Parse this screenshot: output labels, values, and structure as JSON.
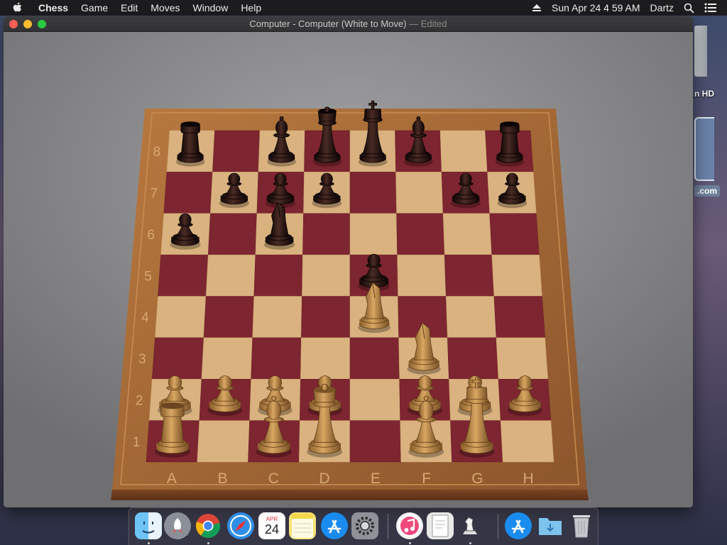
{
  "menubar": {
    "app_name": "Chess",
    "items": [
      "Game",
      "Edit",
      "Moves",
      "Window",
      "Help"
    ],
    "clock": "Sun Apr 24  4 59 AM",
    "user": "Dartz",
    "icons": [
      "apple-icon",
      "eject-icon",
      "spotlight-search-icon",
      "notification-center-icon"
    ]
  },
  "desktop": {
    "hd_label": "n HD",
    "image_label": ".com"
  },
  "window": {
    "title": "Computer - Computer   (White to Move)",
    "edited": " — Edited"
  },
  "board": {
    "files": [
      "A",
      "B",
      "C",
      "D",
      "E",
      "F",
      "G",
      "H"
    ],
    "ranks": [
      "8",
      "7",
      "6",
      "5",
      "4",
      "3",
      "2",
      "1"
    ],
    "colors": {
      "light": "#d9b27f",
      "dark": "#7d2530",
      "frame": "#a5693a",
      "white_piece": "#c8964f",
      "black_piece": "#2a1714"
    },
    "pieces": [
      {
        "color": "black",
        "type": "rook",
        "square": "a8"
      },
      {
        "color": "black",
        "type": "bishop",
        "square": "c8"
      },
      {
        "color": "black",
        "type": "queen",
        "square": "d8"
      },
      {
        "color": "black",
        "type": "king",
        "square": "e8"
      },
      {
        "color": "black",
        "type": "bishop",
        "square": "f8"
      },
      {
        "color": "black",
        "type": "rook",
        "square": "h8"
      },
      {
        "color": "black",
        "type": "pawn",
        "square": "b7"
      },
      {
        "color": "black",
        "type": "pawn",
        "square": "c7"
      },
      {
        "color": "black",
        "type": "pawn",
        "square": "d7"
      },
      {
        "color": "black",
        "type": "pawn",
        "square": "g7"
      },
      {
        "color": "black",
        "type": "pawn",
        "square": "h7"
      },
      {
        "color": "black",
        "type": "pawn",
        "square": "a6"
      },
      {
        "color": "black",
        "type": "knight",
        "square": "c6"
      },
      {
        "color": "black",
        "type": "pawn",
        "square": "e5"
      },
      {
        "color": "white",
        "type": "knight",
        "square": "e4"
      },
      {
        "color": "white",
        "type": "knight",
        "square": "f3"
      },
      {
        "color": "white",
        "type": "pawn",
        "square": "a2"
      },
      {
        "color": "white",
        "type": "pawn",
        "square": "b2"
      },
      {
        "color": "white",
        "type": "pawn",
        "square": "c2"
      },
      {
        "color": "white",
        "type": "pawn",
        "square": "d2"
      },
      {
        "color": "white",
        "type": "pawn",
        "square": "f2"
      },
      {
        "color": "white",
        "type": "pawn",
        "square": "g2"
      },
      {
        "color": "white",
        "type": "pawn",
        "square": "h2"
      },
      {
        "color": "white",
        "type": "rook",
        "square": "a1"
      },
      {
        "color": "white",
        "type": "bishop",
        "square": "c1"
      },
      {
        "color": "white",
        "type": "queen",
        "square": "d1"
      },
      {
        "color": "white",
        "type": "bishop",
        "square": "f1"
      },
      {
        "color": "white",
        "type": "king",
        "square": "g1"
      }
    ]
  },
  "dock": {
    "calendar_month": "APR",
    "calendar_day": "24",
    "apps": [
      {
        "name": "finder-icon",
        "color": "#3b8fe0",
        "running": true
      },
      {
        "name": "launchpad-icon",
        "color": "#8a8f98",
        "running": false
      },
      {
        "name": "chrome-icon",
        "color": "#e8e8e8",
        "running": true
      },
      {
        "name": "safari-icon",
        "color": "#2e8fe8",
        "running": false
      },
      {
        "name": "calendar-icon",
        "color": "#ffffff",
        "running": false
      },
      {
        "name": "notes-icon",
        "color": "#f7e27a",
        "running": false
      },
      {
        "name": "app-store-icon",
        "color": "#1a8cf0",
        "running": false
      },
      {
        "name": "system-preferences-icon",
        "color": "#8f9399",
        "running": false
      },
      {
        "name": "itunes-icon",
        "color": "#f1f1f1",
        "running": true
      },
      {
        "name": "preview-icon",
        "color": "#e9e9e9",
        "running": false
      },
      {
        "name": "chess-icon",
        "color": "#7b7b7e",
        "running": true
      },
      {
        "name": "app-store-downloads-icon",
        "color": "#1a8cf0",
        "running": false
      },
      {
        "name": "downloads-folder-icon",
        "color": "#6fb8e8",
        "running": false
      },
      {
        "name": "trash-icon",
        "color": "#b9bcc1",
        "running": false
      }
    ]
  }
}
